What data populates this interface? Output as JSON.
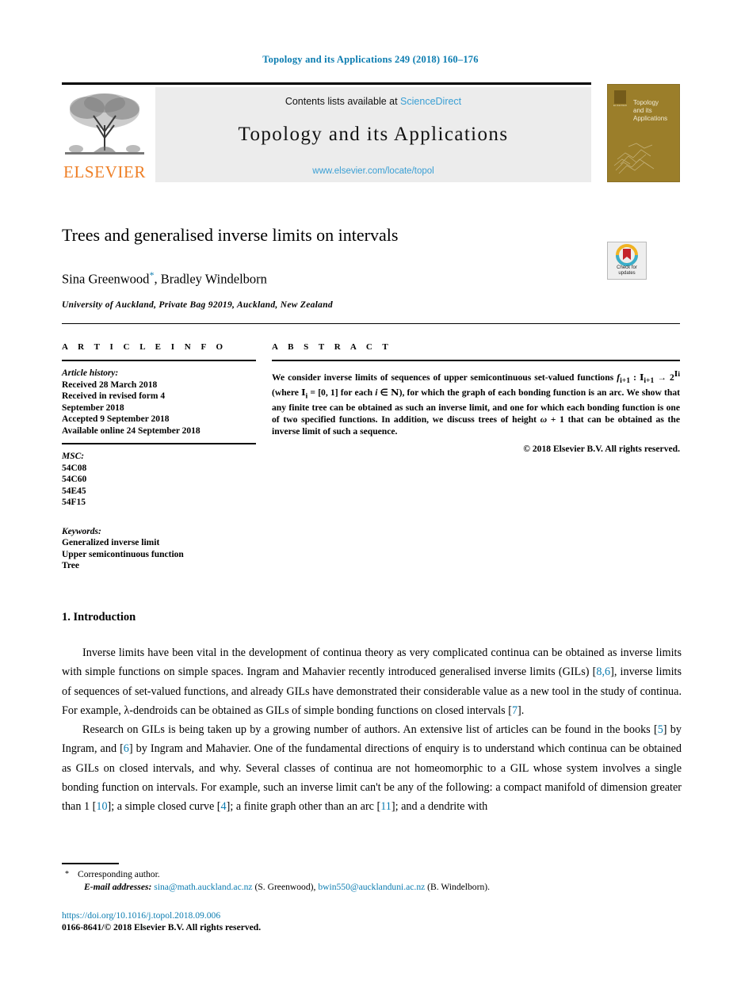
{
  "running_head": "Topology and its Applications 249 (2018) 160–176",
  "masthead": {
    "contents_line_prefix": "Contents lists available at ",
    "sciencedirect_link": "ScienceDirect",
    "journal_title": "Topology  and  its  Applications",
    "journal_url": "www.elsevier.com/locate/topol",
    "publisher_name": "ELSEVIER",
    "cover": {
      "title_line1": "Topology",
      "title_line2": "and its",
      "title_line3": "Applications"
    }
  },
  "article": {
    "title": "Trees and generalised inverse limits on intervals",
    "authors": "Sina Greenwood",
    "author_star": "*",
    "authors_rest": ", Bradley Windelborn",
    "affiliation": "University of Auckland, Private Bag 92019, Auckland, New Zealand",
    "crossmark_line1": "Check for",
    "crossmark_line2": "updates"
  },
  "info": {
    "heading": "A R T I C L E    I N F O",
    "history_label": "Article history:",
    "history": [
      "Received 28 March 2018",
      "Received in revised form 4",
      "September 2018",
      "Accepted 9 September 2018",
      "Available online 24 September 2018"
    ],
    "msc_label": "MSC:",
    "msc": [
      "54C08",
      "54C60",
      "54E45",
      "54F15"
    ],
    "keywords_label": "Keywords:",
    "keywords": [
      "Generalized inverse limit",
      "Upper semicontinuous function",
      "Tree"
    ]
  },
  "abstract": {
    "heading": "A B S T R A C T",
    "part1": "We consider inverse limits of sequences of upper semicontinuous set-valued functions ",
    "formula": "f",
    "formula_sub1": "i+1",
    "formula_mid": " : ",
    "formula_dom": "I",
    "formula_dom_sub": "i+1",
    "formula_arrow": " → 2",
    "formula_exp": "I",
    "formula_exp_sub": "i",
    "part2": " (where ",
    "formula_d2": "I",
    "formula_d2_sub": "i",
    "part3": " = [0, 1] for each ",
    "italic_i": "i",
    "part4": " ∈ ",
    "nat": "N",
    "part5": "), for which the graph of each bonding function is an arc. We show that any finite tree can be obtained as such an inverse limit, and one for which each bonding function is one of two specified functions. In addition, we discuss trees of height ",
    "omega": "ω",
    "part6": " + 1 that can be obtained as the inverse limit of such a sequence.",
    "copyright": "© 2018 Elsevier B.V. All rights reserved."
  },
  "section": {
    "number_title": "1.  Introduction"
  },
  "body": {
    "p1_a": "Inverse limits have been vital in the development of continua theory as very complicated continua can be obtained as inverse limits with simple functions on simple spaces. Ingram and Mahavier recently introduced generalised inverse limits (GILs) [",
    "p1_ref1": "8,6",
    "p1_b": "], inverse limits of sequences of set-valued functions, and already GILs have demonstrated their considerable value as a new tool in the study of continua. For example, λ-dendroids can be obtained as GILs of simple bonding functions on closed intervals [",
    "p1_ref2": "7",
    "p1_c": "].",
    "p2_a": "Research on GILs is being taken up by a growing number of authors. An extensive list of articles can be found in the books [",
    "p2_ref1": "5",
    "p2_b": "] by Ingram, and [",
    "p2_ref2": "6",
    "p2_c": "] by Ingram and Mahavier. One of the fundamental directions of enquiry is to understand which continua can be obtained as GILs on closed intervals, and why. Several classes of continua are not homeomorphic to a GIL whose system involves a single bonding function on intervals. For example, such an inverse limit can't be any of the following: a compact manifold of dimension greater than 1 [",
    "p2_ref3": "10",
    "p2_d": "]; a simple closed curve [",
    "p2_ref4": "4",
    "p2_e": "]; a finite graph other than an arc [",
    "p2_ref5": "11",
    "p2_f": "]; and a dendrite with"
  },
  "footer": {
    "corresponding": "Corresponding author.",
    "email_label": "E-mail addresses:",
    "email1": "sina@math.auckland.ac.nz",
    "email1_name": " (S. Greenwood), ",
    "email2": "bwin550@aucklanduni.ac.nz",
    "email2_name": " (B. Windelborn).",
    "doi": "https://doi.org/10.1016/j.topol.2018.09.006",
    "issn": "0166-8641/© 2018 Elsevier B.V. All rights reserved."
  },
  "colors": {
    "link_blue": "#0b7cb0",
    "sd_blue": "#3a9fd4",
    "elsevier_orange": "#ee7e24",
    "cover_gold": "#9b7e2a",
    "band_grey": "#ececec"
  }
}
